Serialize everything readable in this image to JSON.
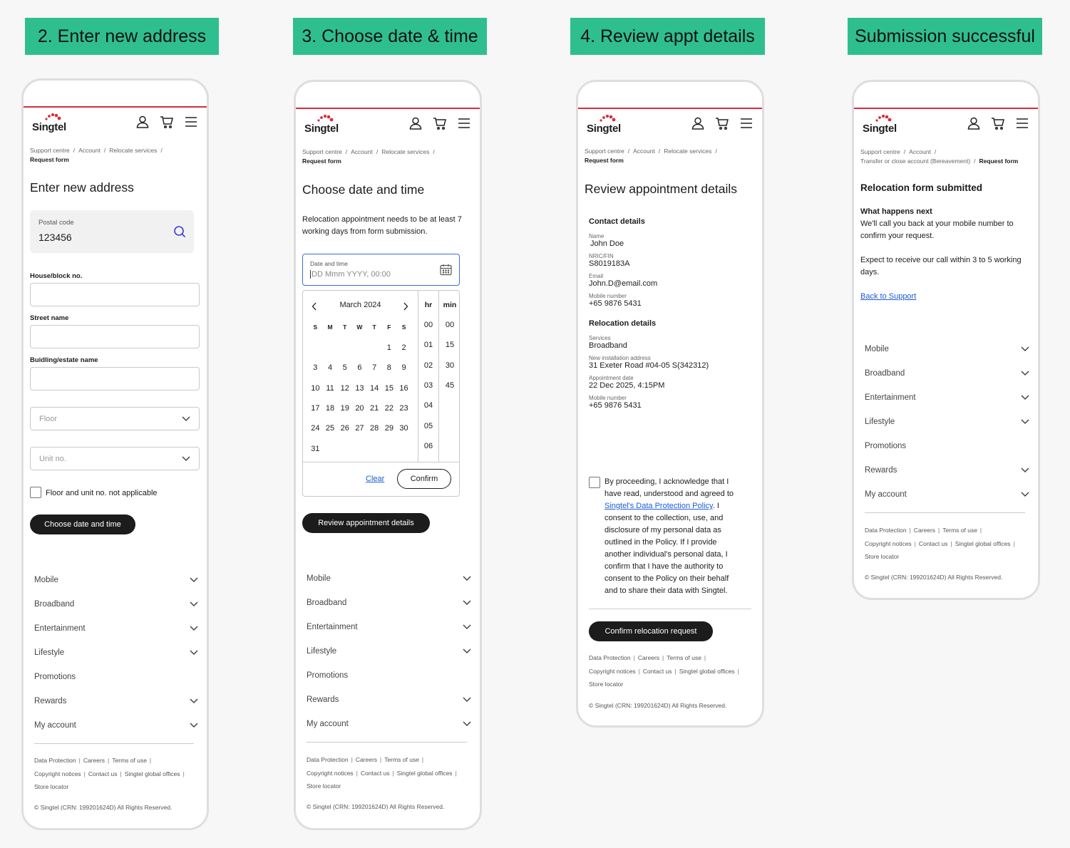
{
  "banners": [
    "2. Enter new address",
    "3. Choose date & time",
    "4. Review appt details",
    "Submission successful"
  ],
  "brand": {
    "name": "Singtel",
    "accent": "#2fbf8f",
    "red": "#d62e3c"
  },
  "header_icons": [
    "user-icon",
    "cart-icon",
    "menu-icon"
  ],
  "footer": {
    "accordion": [
      "Mobile",
      "Broadband",
      "Entertainment",
      "Lifestyle",
      "Promotions",
      "Rewards",
      "My account"
    ],
    "links": {
      "data_protection": "Data Protection",
      "careers": "Careers",
      "terms": "Terms of use",
      "copyright": "Copyright notices",
      "contact": "Contact us",
      "global": "Singtel global offices",
      "store": "Store locator",
      "sep": "|"
    },
    "copyright": "© Singtel (CRN: 199201624D) All Rights Reserved."
  },
  "screen1": {
    "breadcrumb": {
      "c1": "Support centre",
      "c2": "Account",
      "c3": "Relocate services",
      "sep": "/",
      "current": "Request form"
    },
    "title": "Enter new address",
    "postal": {
      "label": "Postal code",
      "value": "123456"
    },
    "house_label": "House/block no.",
    "street_label": "Street name",
    "building_label": "Buidling/estate name",
    "floor_placeholder": "Floor",
    "unit_placeholder": "Unit no.",
    "checkbox_label": "Floor and unit no. not applicable",
    "cta": "Choose date and time"
  },
  "screen2": {
    "breadcrumb": {
      "c1": "Support centre",
      "c2": "Account",
      "c3": "Relocate services",
      "sep": "/",
      "current": "Request form"
    },
    "title": "Choose date and time",
    "intro": "Relocation appointment needs to be at least 7 working days from form submission.",
    "field_label": "Date and time",
    "field_placeholder": "DD Mmm YYYY, 00:00",
    "month": "March 2024",
    "weekdays": [
      "S",
      "M",
      "T",
      "W",
      "T",
      "F",
      "S"
    ],
    "weeks": [
      [
        "",
        "",
        "",
        "",
        "",
        "1",
        "2"
      ],
      [
        "3",
        "4",
        "5",
        "6",
        "7",
        "8",
        "9"
      ],
      [
        "10",
        "11",
        "12",
        "13",
        "14",
        "15",
        "16"
      ],
      [
        "17",
        "18",
        "19",
        "20",
        "21",
        "22",
        "23"
      ],
      [
        "24",
        "25",
        "26",
        "27",
        "28",
        "29",
        "30"
      ],
      [
        "31",
        "",
        "",
        "",
        "",
        "",
        ""
      ]
    ],
    "hr_header": "hr",
    "min_header": "min",
    "hours": [
      "00",
      "01",
      "02",
      "03",
      "04",
      "05",
      "06"
    ],
    "minutes": [
      "00",
      "15",
      "30",
      "45"
    ],
    "clear": "Clear",
    "confirm": "Confirm",
    "cta": "Review appointment details"
  },
  "screen3": {
    "breadcrumb": {
      "c1": "Support centre",
      "c2": "Account",
      "c3": "Relocate services",
      "sep": "/",
      "current": "Request form"
    },
    "title": "Review appointment details",
    "contact_heading": "Contact details",
    "contact": [
      {
        "label": "Name",
        "value": "John Doe"
      },
      {
        "label": "NRIC/FIN",
        "value": "S8019183A"
      },
      {
        "label": "Email",
        "value": "John.D@email.com"
      },
      {
        "label": "Mobile number",
        "value": "+65 9876 5431"
      }
    ],
    "relocation_heading": "Relocation details",
    "relocation": [
      {
        "label": "Services",
        "value": "Broadband"
      },
      {
        "label": "New installation address",
        "value": "31 Exeter Road #04-05 S(342312)"
      },
      {
        "label": "Appointment date",
        "value": "22 Dec 2025, 4:15PM"
      },
      {
        "label": "Mobile number",
        "value": "+65 9876 5431"
      }
    ],
    "consent_before": "By proceeding, I acknowledge that I have read, understood and agreed to",
    "consent_link": "Singtel's Data Protection Policy",
    "consent_after": ". I consent to the collection, use, and disclosure of my personal data as outlined in the Policy. If I provide another individual's personal data, I confirm that I have the authority to consent to the Policy on their behalf and to share their data with Singtel.",
    "cta": "Confirm relocation request"
  },
  "screen4": {
    "breadcrumb": {
      "c1": "Support centre",
      "c2": "Account",
      "sep": "/",
      "c3": "Transfer or close account (Bereavement)",
      "current": "Request form"
    },
    "title": "Relocation form submitted",
    "next_heading": "What happens next",
    "next_body": "We'll call you back at your mobile number to confirm your request.",
    "expect": "Expect to receive our call within 3 to 5 working days.",
    "back_link": "Back to Support"
  }
}
